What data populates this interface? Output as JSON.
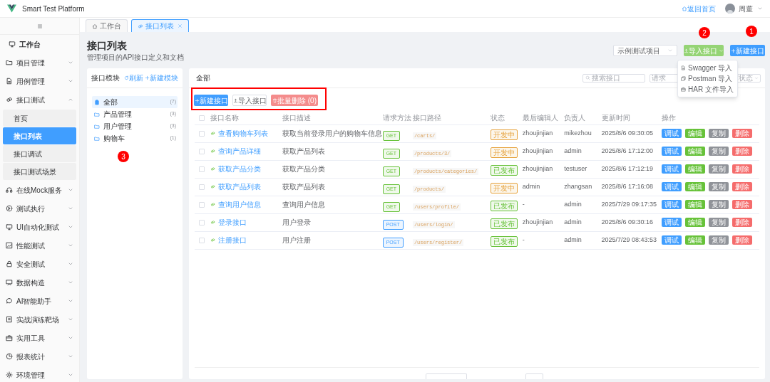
{
  "header": {
    "title": "Smart Test Platform",
    "home_link": "返回首页",
    "user": "周董"
  },
  "sidebar": {
    "items": [
      {
        "label": "工作台",
        "kind": "link",
        "selected": false
      },
      {
        "label": "项目管理",
        "kind": "group",
        "expanded": false,
        "selected": false
      },
      {
        "label": "用例管理",
        "kind": "group",
        "expanded": false,
        "selected": false
      },
      {
        "label": "接口测试",
        "kind": "group",
        "expanded": true,
        "selected": false,
        "children": [
          {
            "label": "首页",
            "selected": false
          },
          {
            "label": "接口列表",
            "selected": true
          },
          {
            "label": "接口调试",
            "selected": false
          },
          {
            "label": "接口测试场景",
            "selected": false
          }
        ]
      },
      {
        "label": "在线Mock服务",
        "kind": "group",
        "expanded": false,
        "selected": false
      },
      {
        "label": "测试执行",
        "kind": "group",
        "expanded": false,
        "selected": false
      },
      {
        "label": "UI自动化测试",
        "kind": "group",
        "expanded": false,
        "selected": false
      },
      {
        "label": "性能测试",
        "kind": "group",
        "expanded": false,
        "selected": false
      },
      {
        "label": "安全测试",
        "kind": "group",
        "expanded": false,
        "selected": false
      },
      {
        "label": "数据构造",
        "kind": "group",
        "expanded": false,
        "selected": false
      },
      {
        "label": "AI智能助手",
        "kind": "group",
        "expanded": false,
        "selected": false
      },
      {
        "label": "实战演练靶场",
        "kind": "group",
        "expanded": false,
        "selected": false
      },
      {
        "label": "实用工具",
        "kind": "group",
        "expanded": false,
        "selected": false
      },
      {
        "label": "报表统计",
        "kind": "group",
        "expanded": false,
        "selected": false
      },
      {
        "label": "环境管理",
        "kind": "group",
        "expanded": false,
        "selected": false
      }
    ]
  },
  "tabs": [
    {
      "label": "工作台",
      "selected": false,
      "closable": false
    },
    {
      "label": "接口列表",
      "selected": true,
      "closable": true
    }
  ],
  "page": {
    "title": "接口列表",
    "subtitle": "管理项目的API接口定义和文档",
    "project_select": "示例测试项目",
    "import_button": "导入接口",
    "new_button": "新建接口",
    "import_menu": [
      {
        "label": "Swagger 导入"
      },
      {
        "label": "Postman 导入"
      },
      {
        "label": "HAR 文件导入"
      }
    ]
  },
  "modules": {
    "title": "接口模块",
    "refresh": "刷新",
    "new": "新建模块",
    "items": [
      {
        "label": "全部",
        "count": "(7)",
        "kind": "all",
        "selected": true
      },
      {
        "label": "产品管理",
        "count": "(3)",
        "kind": "folder",
        "selected": false
      },
      {
        "label": "用户管理",
        "count": "(3)",
        "kind": "folder",
        "selected": false
      },
      {
        "label": "购物车",
        "count": "(1)",
        "kind": "folder",
        "selected": false
      }
    ]
  },
  "list": {
    "heading": "全部",
    "search": {
      "placeholder": "搜索接口"
    },
    "filters": [
      {
        "placeholder": "请求"
      },
      {
        "placeholder": "状态"
      }
    ],
    "toolbar": [
      {
        "label": "新建接口",
        "kind": "primary",
        "disabled": false
      },
      {
        "label": "导入接口",
        "kind": "plain",
        "disabled": false
      },
      {
        "label": "批量删除 (0)",
        "kind": "danger",
        "disabled": true
      }
    ],
    "select_all_checked": false,
    "columns": [
      "接口名称",
      "接口描述",
      "请求方法",
      "接口路径",
      "状态",
      "最后编辑人",
      "负责人",
      "更新时间",
      "操作"
    ],
    "rows": [
      {
        "checked": false,
        "name": "查看购物车列表",
        "description": "获取当前登录用户的购物车信息",
        "method": {
          "label": "GET",
          "color": "#67c23a"
        },
        "path": "/carts/",
        "status": {
          "label": "开发中",
          "color": "#e6a23c"
        },
        "editor": "zhoujinjian",
        "owner": "mikezhou",
        "updated": "2025/8/6 09:30:05",
        "actions": [
          "调试",
          "编辑",
          "复制",
          "删除"
        ]
      },
      {
        "checked": false,
        "name": "查询产品详细",
        "description": "获取产品列表",
        "method": {
          "label": "GET",
          "color": "#67c23a"
        },
        "path": "/products/3/",
        "status": {
          "label": "开发中",
          "color": "#e6a23c"
        },
        "editor": "zhoujinjian",
        "owner": "admin",
        "updated": "2025/8/6 17:12:00",
        "actions": [
          "调试",
          "编辑",
          "复制",
          "删除"
        ]
      },
      {
        "checked": false,
        "name": "获取产品分类",
        "description": "获取产品分类",
        "method": {
          "label": "GET",
          "color": "#67c23a"
        },
        "path": "/products/categories/",
        "status": {
          "label": "已发布",
          "color": "#67c23a"
        },
        "editor": "zhoujinjian",
        "owner": "testuser",
        "updated": "2025/8/6 17:12:19",
        "actions": [
          "调试",
          "编辑",
          "复制",
          "删除"
        ]
      },
      {
        "checked": false,
        "name": "获取产品列表",
        "description": "获取产品列表",
        "method": {
          "label": "GET",
          "color": "#67c23a"
        },
        "path": "/products/",
        "status": {
          "label": "开发中",
          "color": "#e6a23c"
        },
        "editor": "admin",
        "owner": "zhangsan",
        "updated": "2025/8/6 17:16:08",
        "actions": [
          "调试",
          "编辑",
          "复制",
          "删除"
        ]
      },
      {
        "checked": false,
        "name": "查询用户信息",
        "description": "查询用户信息",
        "method": {
          "label": "GET",
          "color": "#67c23a"
        },
        "path": "/users/profile/",
        "status": {
          "label": "已发布",
          "color": "#67c23a"
        },
        "editor": "-",
        "owner": "admin",
        "updated": "2025/7/29 09:17:35",
        "actions": [
          "调试",
          "编辑",
          "复制",
          "删除"
        ]
      },
      {
        "checked": false,
        "name": "登录接口",
        "description": "用户登录",
        "method": {
          "label": "POST",
          "color": "#409eff"
        },
        "path": "/users/login/",
        "status": {
          "label": "已发布",
          "color": "#67c23a"
        },
        "editor": "zhoujinjian",
        "owner": "admin",
        "updated": "2025/8/6 09:30:16",
        "actions": [
          "调试",
          "编辑",
          "复制",
          "删除"
        ]
      },
      {
        "checked": false,
        "name": "注册接口",
        "description": "用户注册",
        "method": {
          "label": "POST",
          "color": "#409eff"
        },
        "path": "/users/register/",
        "status": {
          "label": "已发布",
          "color": "#67c23a"
        },
        "editor": "-",
        "owner": "admin",
        "updated": "2025/7/29 08:43:53",
        "actions": [
          "调试",
          "编辑",
          "复制",
          "删除"
        ]
      }
    ]
  },
  "markers": [
    {
      "label": "1"
    },
    {
      "label": "2"
    },
    {
      "label": "3"
    }
  ]
}
